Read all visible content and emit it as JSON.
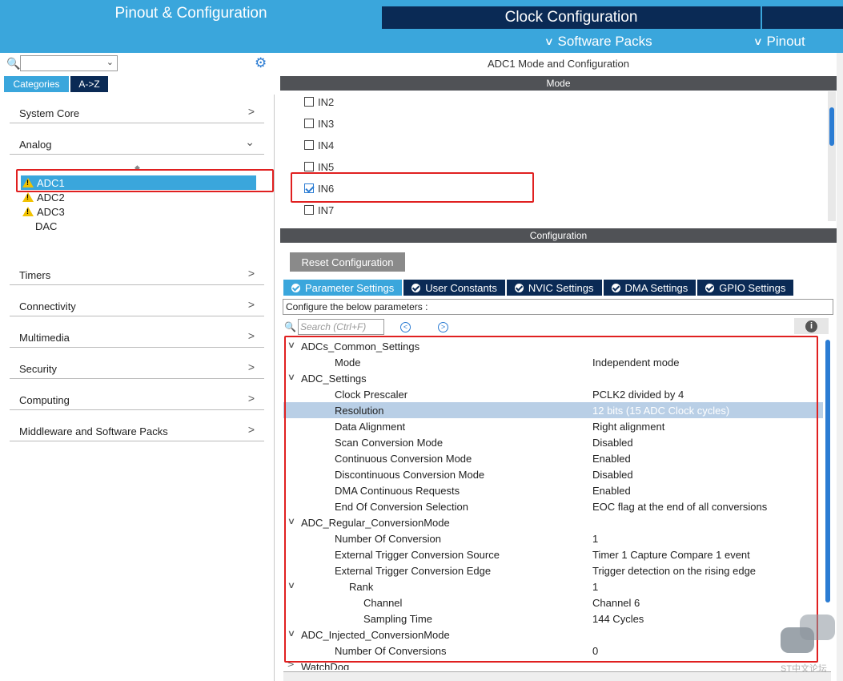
{
  "header": {
    "tab_pinout": "Pinout & Configuration",
    "tab_clock": "Clock Configuration",
    "software_packs": "Software Packs",
    "pinout": "Pinout"
  },
  "sidebar": {
    "tabs": {
      "categories": "Categories",
      "az": "A->Z"
    },
    "categories": [
      "System Core",
      "Analog",
      "Timers",
      "Connectivity",
      "Multimedia",
      "Security",
      "Computing",
      "Middleware and Software Packs"
    ],
    "analog_items": [
      "ADC1",
      "ADC2",
      "ADC3",
      "DAC"
    ]
  },
  "main": {
    "title": "ADC1 Mode and Configuration",
    "mode_header": "Mode",
    "mode_inputs": [
      {
        "label": "IN2",
        "checked": false
      },
      {
        "label": "IN3",
        "checked": false
      },
      {
        "label": "IN4",
        "checked": false
      },
      {
        "label": "IN5",
        "checked": false
      },
      {
        "label": "IN6",
        "checked": true
      },
      {
        "label": "IN7",
        "checked": false
      }
    ],
    "config_header": "Configuration",
    "reset_button": "Reset Configuration",
    "tabs": [
      "Parameter Settings",
      "User Constants",
      "NVIC Settings",
      "DMA Settings",
      "GPIO Settings"
    ],
    "configure_label": "Configure the below parameters :",
    "search_placeholder": "Search (Ctrl+F)",
    "params": [
      {
        "name": "ADCs_Common_Settings",
        "value": ""
      },
      {
        "name": "Mode",
        "value": "Independent mode"
      },
      {
        "name": "ADC_Settings",
        "value": ""
      },
      {
        "name": "Clock Prescaler",
        "value": "PCLK2 divided by 4"
      },
      {
        "name": "Resolution",
        "value": "12 bits (15 ADC Clock cycles)"
      },
      {
        "name": "Data Alignment",
        "value": "Right alignment"
      },
      {
        "name": "Scan Conversion Mode",
        "value": "Disabled"
      },
      {
        "name": "Continuous Conversion Mode",
        "value": "Enabled"
      },
      {
        "name": "Discontinuous Conversion Mode",
        "value": "Disabled"
      },
      {
        "name": "DMA Continuous Requests",
        "value": "Enabled"
      },
      {
        "name": "End Of Conversion Selection",
        "value": "EOC flag at the end of all conversions"
      },
      {
        "name": "ADC_Regular_ConversionMode",
        "value": ""
      },
      {
        "name": "Number Of Conversion",
        "value": "1"
      },
      {
        "name": "External Trigger Conversion Source",
        "value": "Timer 1 Capture Compare 1 event"
      },
      {
        "name": "External Trigger Conversion Edge",
        "value": "Trigger detection on the rising edge"
      },
      {
        "name": "Rank",
        "value": "1"
      },
      {
        "name": "Channel",
        "value": "Channel 6"
      },
      {
        "name": "Sampling Time",
        "value": "144 Cycles"
      },
      {
        "name": "ADC_Injected_ConversionMode",
        "value": ""
      },
      {
        "name": "Number Of Conversions",
        "value": "0"
      },
      {
        "name": "WatchDog",
        "value": ""
      }
    ]
  },
  "watermark": "ST中文论坛",
  "colors": {
    "accent": "#3aa6dc",
    "dark": "#0a2a55",
    "highlight": "#b9cfe6",
    "annotation": "#e02020"
  }
}
